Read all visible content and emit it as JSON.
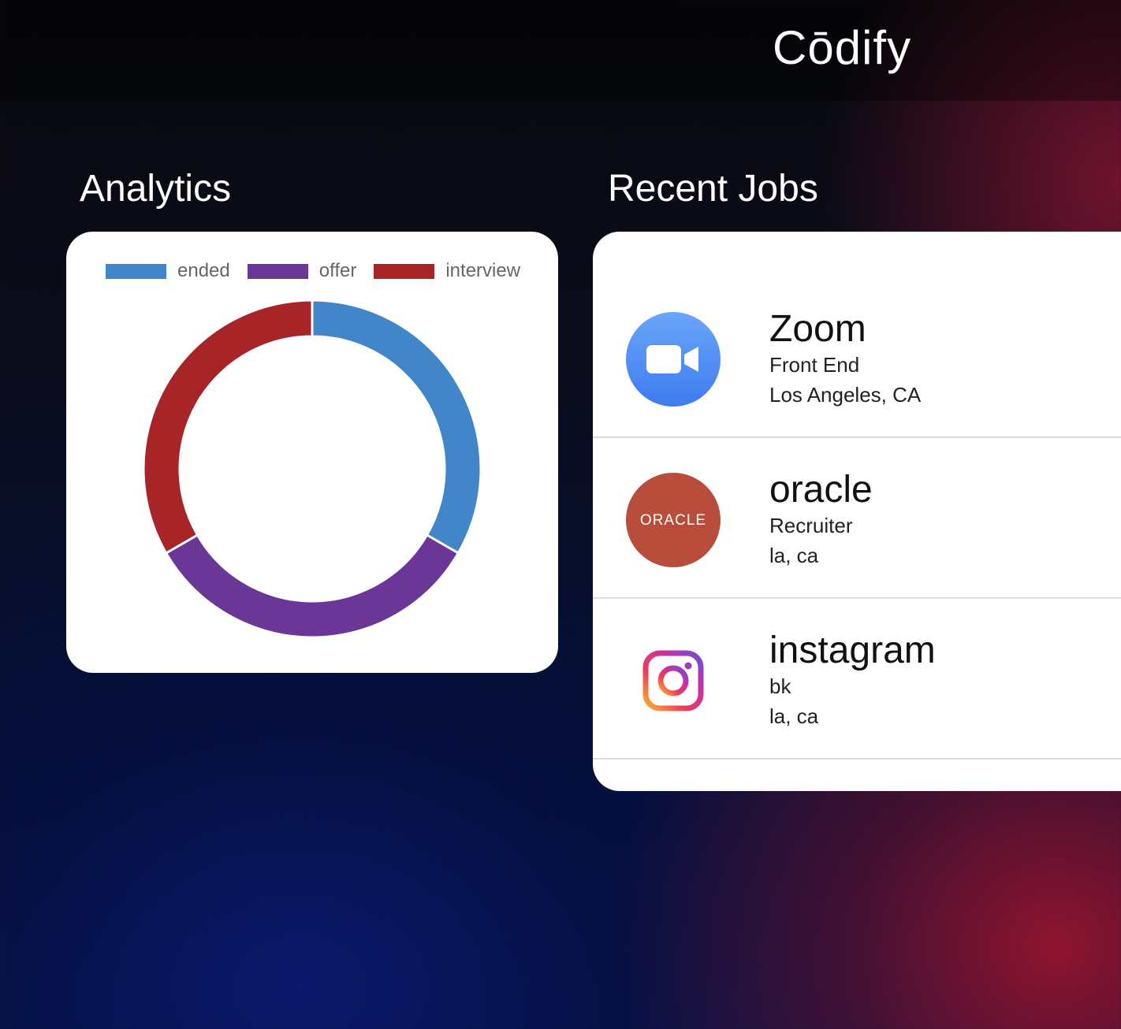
{
  "brand": {
    "name": "Cōdify"
  },
  "analytics": {
    "title": "Analytics"
  },
  "chart_data": {
    "type": "pie",
    "donut": true,
    "legend_position": "top",
    "categories": [
      "ended",
      "offer",
      "interview"
    ],
    "values": [
      1,
      1,
      1
    ],
    "colors": [
      "#4186c9",
      "#6a3796",
      "#a72427"
    ]
  },
  "recent_jobs": {
    "title": "Recent Jobs",
    "items": [
      {
        "company": "Zoom",
        "role": "Front End",
        "location": "Los Angeles, CA",
        "icon": "zoom-logo",
        "color": "#4a8cf2"
      },
      {
        "company": "oracle",
        "role": "Recruiter",
        "location": "la, ca",
        "icon": "oracle-logo",
        "logo_text": "ORACLE",
        "color": "#b84d3c"
      },
      {
        "company": "instagram",
        "role": "bk",
        "location": "la, ca",
        "icon": "instagram-logo"
      }
    ]
  }
}
